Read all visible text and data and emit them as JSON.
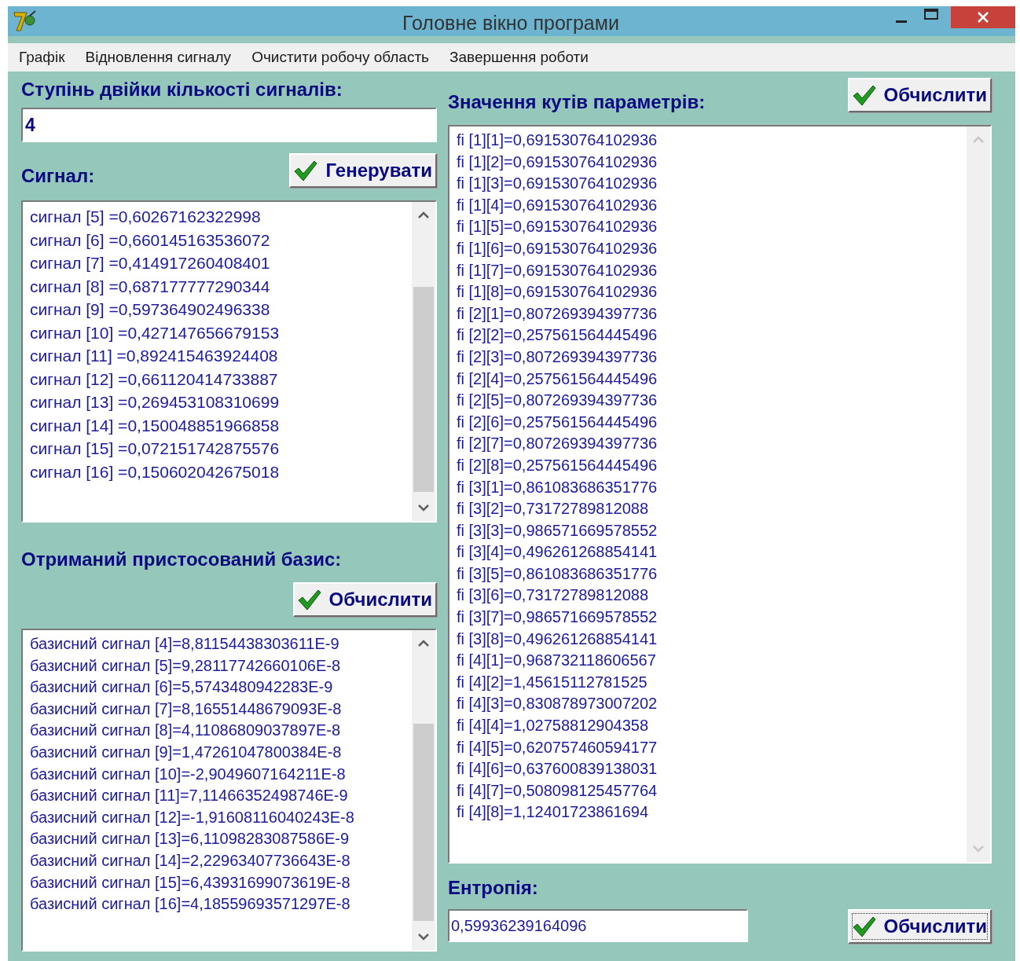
{
  "window": {
    "title": "Головне вікно програми"
  },
  "menu": [
    {
      "label": "Графік"
    },
    {
      "label": "Відновлення сигналу"
    },
    {
      "label": "Очистити робочу область"
    },
    {
      "label": "Завершення роботи"
    }
  ],
  "power": {
    "label": "Ступінь двійки кількості сигналів:",
    "value": "4"
  },
  "signal": {
    "label": "Сигнал:",
    "button": {
      "label": "Генерувати",
      "focused": false
    },
    "items": [
      "сигнал [5] =0,60267162322998",
      "сигнал [6] =0,660145163536072",
      "сигнал [7] =0,414917260408401",
      "сигнал [8] =0,687177777290344",
      "сигнал [9] =0,597364902496338",
      "сигнал [10] =0,427147656679153",
      "сигнал [11] =0,892415463924408",
      "сигнал [12] =0,661120414733887",
      "сигнал [13] =0,269453108310699",
      "сигнал [14] =0,150048851966858",
      "сигнал [15] =0,072151742875576",
      "сигнал [16] =0,150602042675018"
    ]
  },
  "basis": {
    "label": "Отриманий пристосований базис:",
    "button": {
      "label": "Обчислити",
      "focused": false
    },
    "items": [
      "базисний сигнал [4]=8,81154438303611E-9",
      "базисний сигнал [5]=9,28117742660106E-8",
      "базисний сигнал [6]=5,5743480942283E-9",
      "базисний сигнал [7]=8,16551448679093E-8",
      "базисний сигнал [8]=4,11086809037897E-8",
      "базисний сигнал [9]=1,47261047800384E-8",
      "базисний сигнал [10]=-2,9049607164211E-8",
      "базисний сигнал [11]=7,11466352498746E-9",
      "базисний сигнал [12]=-1,91608116040243E-8",
      "базисний сигнал [13]=6,11098283087586E-9",
      "базисний сигнал [14]=2,22963407736643E-8",
      "базисний сигнал [15]=6,43931699073619E-8",
      "базисний сигнал [16]=4,18559693571297E-8"
    ]
  },
  "angles": {
    "label": "Значення кутів параметрів:",
    "button": {
      "label": "Обчислити",
      "focused": false
    },
    "items": [
      "fi [1][1]=0,691530764102936",
      "fi [1][2]=0,691530764102936",
      "fi [1][3]=0,691530764102936",
      "fi [1][4]=0,691530764102936",
      "fi [1][5]=0,691530764102936",
      "fi [1][6]=0,691530764102936",
      "fi [1][7]=0,691530764102936",
      "fi [1][8]=0,691530764102936",
      "fi [2][1]=0,807269394397736",
      "fi [2][2]=0,257561564445496",
      "fi [2][3]=0,807269394397736",
      "fi [2][4]=0,257561564445496",
      "fi [2][5]=0,807269394397736",
      "fi [2][6]=0,257561564445496",
      "fi [2][7]=0,807269394397736",
      "fi [2][8]=0,257561564445496",
      "fi [3][1]=0,861083686351776",
      "fi [3][2]=0,73172789812088",
      "fi [3][3]=0,986571669578552",
      "fi [3][4]=0,496261268854141",
      "fi [3][5]=0,861083686351776",
      "fi [3][6]=0,73172789812088",
      "fi [3][7]=0,986571669578552",
      "fi [3][8]=0,496261268854141",
      "fi [4][1]=0,968732118606567",
      "fi [4][2]=1,45615112781525",
      "fi [4][3]=0,830878973007202",
      "fi [4][4]=1,02758812904358",
      "fi [4][5]=0,620757460594177",
      "fi [4][6]=0,637600839138031",
      "fi [4][7]=0,508098125457764",
      "fi [4][8]=1,12401723861694"
    ]
  },
  "entropy": {
    "label": "Ентропія:",
    "value": "0,59936239164096",
    "button": {
      "label": "Обчислити",
      "focused": true
    }
  }
}
